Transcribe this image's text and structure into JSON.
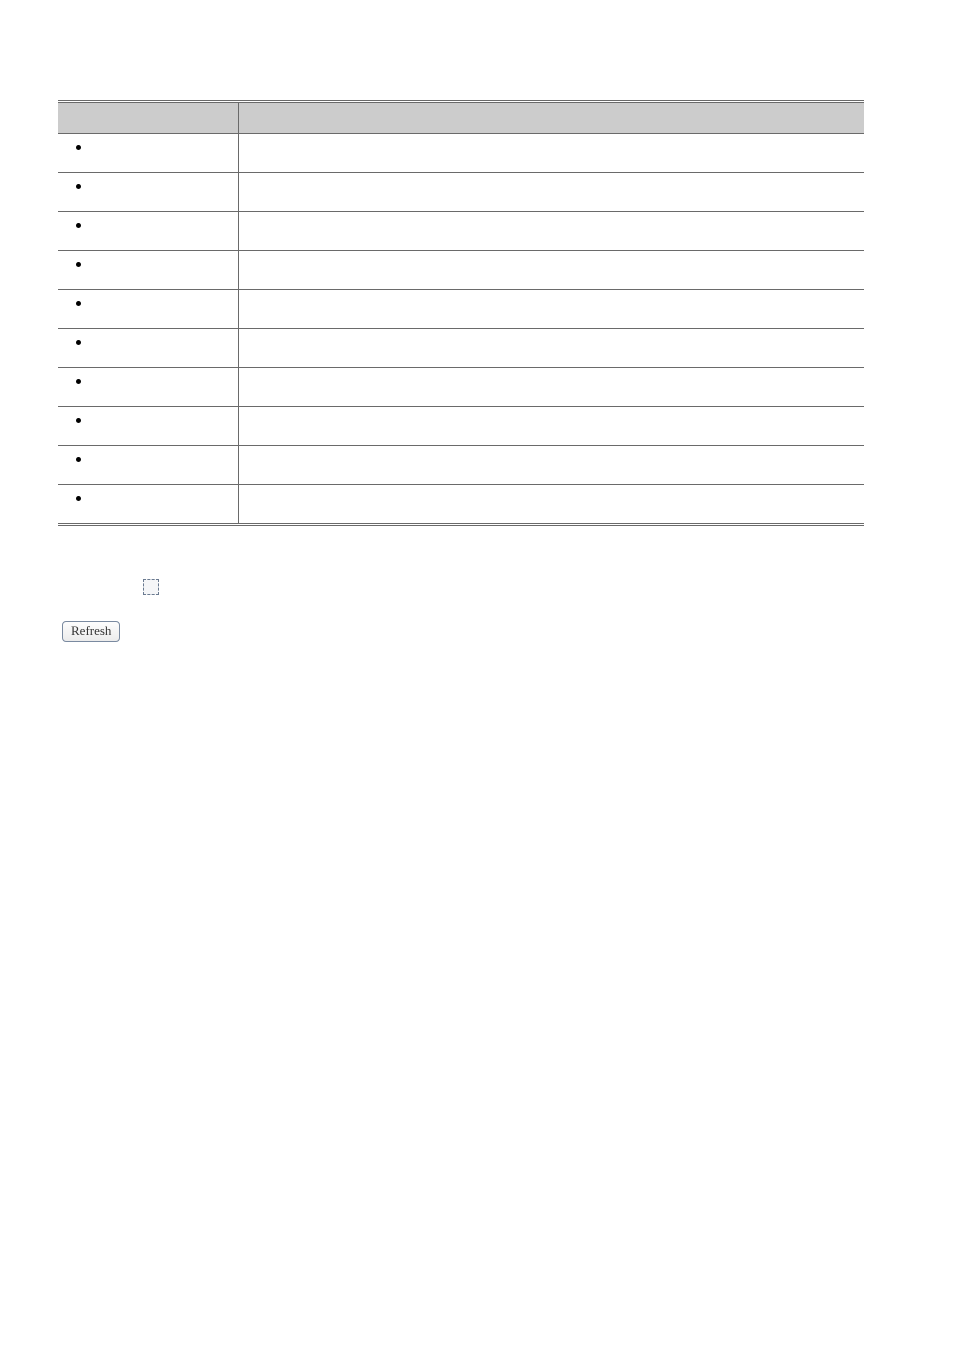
{
  "table": {
    "headers": [
      "",
      ""
    ],
    "rows": [
      {
        "left": "",
        "right": ""
      },
      {
        "left": "",
        "right": ""
      },
      {
        "left": "",
        "right": ""
      },
      {
        "left": "",
        "right": ""
      },
      {
        "left": "",
        "right": ""
      },
      {
        "left": "",
        "right": ""
      },
      {
        "left": "",
        "right": ""
      },
      {
        "left": "",
        "right": ""
      },
      {
        "left": "",
        "right": ""
      },
      {
        "left": "",
        "right": ""
      }
    ]
  },
  "controls": {
    "checkbox_label": "",
    "refresh_label": "Refresh"
  }
}
